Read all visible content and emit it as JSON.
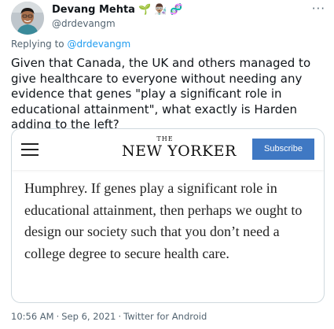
{
  "tweet": {
    "author": {
      "name": "Devang Mehta",
      "handle": "@drdevangm",
      "name_emojis": [
        "🌱",
        "👨🏽‍🔬",
        "🧬"
      ]
    },
    "more_label": "···",
    "replying": {
      "prefix": "Replying to",
      "mention": "@drdevangm"
    },
    "text": "Given that Canada, the UK and others managed to give healthcare to everyone without needing any evidence that genes \"play a significant role in educational attainment\", what exactly is Harden adding to the left?",
    "media": {
      "logo_small": "THE",
      "logo_main": "NEW YORKER",
      "subscribe_label": "Subscribe",
      "article_text": "Humphrey. If genes play a significant role in educational attainment, then perhaps we ought to design our society such that you don’t need a college degree to secure health care."
    },
    "footer": {
      "time": "10:56 AM",
      "date": "Sep 6, 2021",
      "source": "Twitter for Android",
      "separator": "·"
    }
  },
  "colors": {
    "link": "#1d9bf0",
    "secondary_text": "#536471",
    "subscribe_bg": "#3f78c3"
  }
}
